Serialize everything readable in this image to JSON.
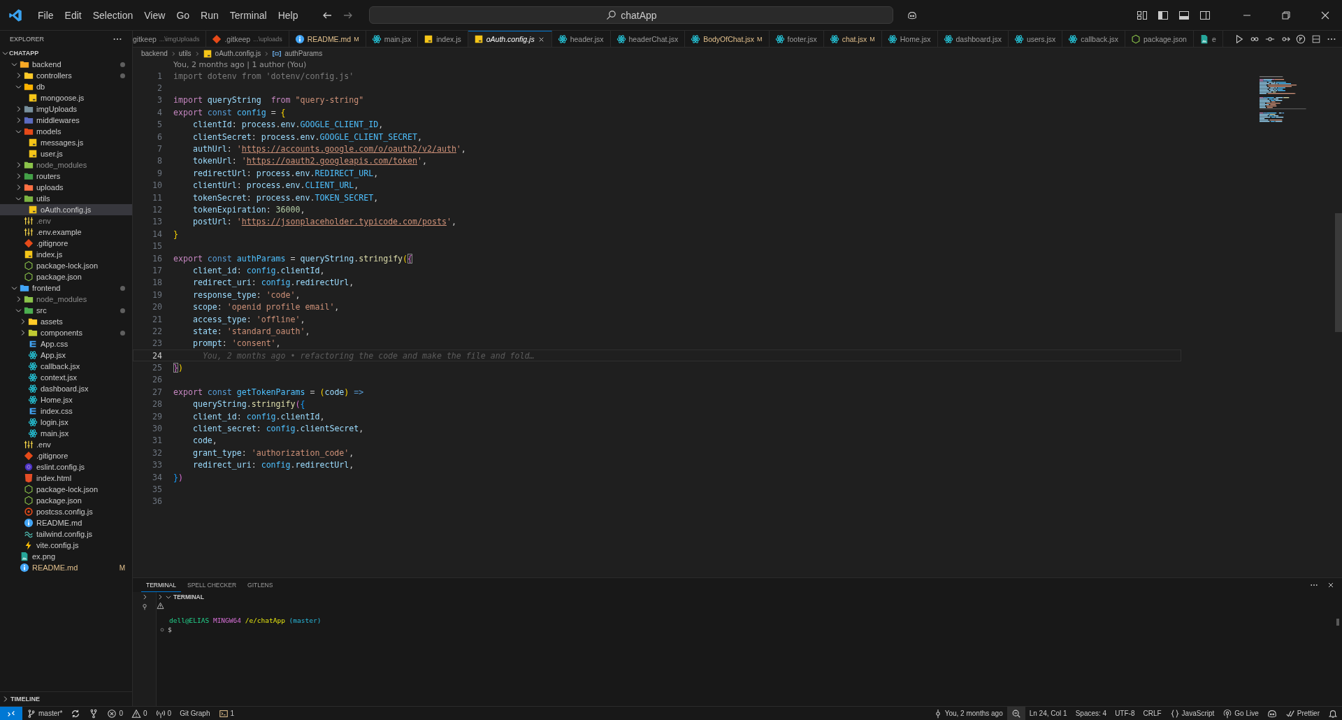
{
  "title_bar": {
    "menus": [
      "File",
      "Edit",
      "Selection",
      "View",
      "Go",
      "Run",
      "Terminal",
      "Help"
    ],
    "search": "chatApp"
  },
  "sidebar": {
    "title": "EXPLORER",
    "root": {
      "label": "CHATAPP",
      "expanded": true
    },
    "tree": [
      {
        "label": "backend",
        "kind": "folder",
        "color": "#f9a825",
        "expanded": true,
        "selected": false,
        "dimmed": false,
        "modified": false,
        "dot": true,
        "children": [
          {
            "label": "controllers",
            "kind": "folder",
            "color": "#ffca28",
            "expanded": false,
            "selected": false,
            "dimmed": false,
            "modified": false,
            "dot": true
          },
          {
            "label": "db",
            "kind": "folder",
            "color": "#ffb300",
            "expanded": true,
            "selected": false,
            "dimmed": false,
            "modified": false,
            "dot": false,
            "children": [
              {
                "label": "mongoose.js",
                "kind": "js",
                "selected": false,
                "dimmed": false,
                "modified": false
              }
            ]
          },
          {
            "label": "imgUploads",
            "kind": "folder",
            "color": "#78909c",
            "expanded": false,
            "selected": false,
            "dimmed": false,
            "modified": false,
            "dot": false
          },
          {
            "label": "middlewares",
            "kind": "folder",
            "color": "#5c6bc0",
            "expanded": false,
            "selected": false,
            "dimmed": false,
            "modified": false,
            "dot": false
          },
          {
            "label": "models",
            "kind": "folder",
            "color": "#e64a19",
            "expanded": true,
            "selected": false,
            "dimmed": false,
            "modified": false,
            "dot": false,
            "children": [
              {
                "label": "messages.js",
                "kind": "js",
                "selected": false,
                "dimmed": false,
                "modified": false
              },
              {
                "label": "user.js",
                "kind": "js",
                "selected": false,
                "dimmed": false,
                "modified": false
              }
            ]
          },
          {
            "label": "node_modules",
            "kind": "folder",
            "color": "#8bc34a",
            "expanded": false,
            "selected": false,
            "dimmed": true,
            "modified": false,
            "dot": false
          },
          {
            "label": "routers",
            "kind": "folder",
            "color": "#43a047",
            "expanded": false,
            "selected": false,
            "dimmed": false,
            "modified": false,
            "dot": false
          },
          {
            "label": "uploads",
            "kind": "folder",
            "color": "#ff7043",
            "expanded": false,
            "selected": false,
            "dimmed": false,
            "modified": false,
            "dot": false
          },
          {
            "label": "utils",
            "kind": "folder",
            "color": "#7cb342",
            "expanded": true,
            "selected": false,
            "dimmed": false,
            "modified": false,
            "dot": false,
            "children": [
              {
                "label": "oAuth.config.js",
                "kind": "js",
                "selected": true,
                "dimmed": false,
                "modified": false
              }
            ]
          },
          {
            "label": ".env",
            "kind": "env",
            "selected": false,
            "dimmed": true,
            "modified": false
          },
          {
            "label": ".env.example",
            "kind": "env",
            "selected": false,
            "dimmed": false,
            "modified": false
          },
          {
            "label": ".gitignore",
            "kind": "git",
            "selected": false,
            "dimmed": false,
            "modified": false
          },
          {
            "label": "index.js",
            "kind": "js",
            "selected": false,
            "dimmed": false,
            "modified": false
          },
          {
            "label": "package-lock.json",
            "kind": "node",
            "selected": false,
            "dimmed": false,
            "modified": false
          },
          {
            "label": "package.json",
            "kind": "node",
            "selected": false,
            "dimmed": false,
            "modified": false
          }
        ]
      },
      {
        "label": "frontend",
        "kind": "folder",
        "color": "#42a5f5",
        "expanded": true,
        "selected": false,
        "dimmed": false,
        "modified": false,
        "dot": true,
        "children": [
          {
            "label": "node_modules",
            "kind": "folder",
            "color": "#8bc34a",
            "expanded": false,
            "selected": false,
            "dimmed": true,
            "modified": false,
            "dot": false
          },
          {
            "label": "src",
            "kind": "folder",
            "color": "#4caf50",
            "expanded": true,
            "selected": false,
            "dimmed": false,
            "modified": false,
            "dot": true,
            "children": [
              {
                "label": "assets",
                "kind": "folder",
                "color": "#ffca28",
                "expanded": false,
                "selected": false,
                "dimmed": false,
                "modified": false,
                "dot": false
              },
              {
                "label": "components",
                "kind": "folder",
                "color": "#c0ca33",
                "expanded": false,
                "selected": false,
                "dimmed": false,
                "modified": false,
                "dot": true
              },
              {
                "label": "App.css",
                "kind": "css",
                "selected": false,
                "dimmed": false,
                "modified": false
              },
              {
                "label": "App.jsx",
                "kind": "react",
                "selected": false,
                "dimmed": false,
                "modified": false
              },
              {
                "label": "callback.jsx",
                "kind": "react",
                "selected": false,
                "dimmed": false,
                "modified": false
              },
              {
                "label": "context.jsx",
                "kind": "react",
                "selected": false,
                "dimmed": false,
                "modified": false
              },
              {
                "label": "dashboard.jsx",
                "kind": "react",
                "selected": false,
                "dimmed": false,
                "modified": false
              },
              {
                "label": "Home.jsx",
                "kind": "react",
                "selected": false,
                "dimmed": false,
                "modified": false
              },
              {
                "label": "index.css",
                "kind": "css",
                "selected": false,
                "dimmed": false,
                "modified": false
              },
              {
                "label": "login.jsx",
                "kind": "react",
                "selected": false,
                "dimmed": false,
                "modified": false
              },
              {
                "label": "main.jsx",
                "kind": "react",
                "selected": false,
                "dimmed": false,
                "modified": false
              }
            ]
          },
          {
            "label": ".env",
            "kind": "env",
            "selected": false,
            "dimmed": false,
            "modified": false
          },
          {
            "label": ".gitignore",
            "kind": "git",
            "selected": false,
            "dimmed": false,
            "modified": false
          },
          {
            "label": "eslint.config.js",
            "kind": "eslint",
            "selected": false,
            "dimmed": false,
            "modified": false
          },
          {
            "label": "index.html",
            "kind": "html",
            "selected": false,
            "dimmed": false,
            "modified": false
          },
          {
            "label": "package-lock.json",
            "kind": "node",
            "selected": false,
            "dimmed": false,
            "modified": false
          },
          {
            "label": "package.json",
            "kind": "node",
            "selected": false,
            "dimmed": false,
            "modified": false
          },
          {
            "label": "postcss.config.js",
            "kind": "postcss",
            "selected": false,
            "dimmed": false,
            "modified": false
          },
          {
            "label": "README.md",
            "kind": "info",
            "selected": false,
            "dimmed": false,
            "modified": false
          },
          {
            "label": "tailwind.config.js",
            "kind": "tailwind",
            "selected": false,
            "dimmed": false,
            "modified": false
          },
          {
            "label": "vite.config.js",
            "kind": "vite",
            "selected": false,
            "dimmed": false,
            "modified": false
          }
        ]
      },
      {
        "label": "ex.png",
        "kind": "image",
        "selected": false,
        "dimmed": false,
        "modified": false
      },
      {
        "label": "README.md",
        "kind": "info",
        "selected": false,
        "dimmed": false,
        "modified": true,
        "badge": "M"
      }
    ],
    "timeline": {
      "label": "TIMELINE",
      "expanded": false
    }
  },
  "tabs": [
    {
      "label": "gitkeep",
      "description": "...\\imgUploads",
      "kind": "plain",
      "selected": false,
      "preview": false,
      "modified": false
    },
    {
      "label": ".gitkeep",
      "description": "...\\uploads",
      "kind": "git",
      "selected": false,
      "preview": false,
      "modified": false
    },
    {
      "label": "README.md",
      "kind": "info",
      "selected": false,
      "preview": false,
      "modified": true,
      "badge": "M"
    },
    {
      "label": "main.jsx",
      "kind": "react",
      "selected": false,
      "preview": false,
      "modified": false
    },
    {
      "label": "index.js",
      "kind": "js",
      "selected": false,
      "preview": false,
      "modified": false
    },
    {
      "label": "oAuth.config.js",
      "kind": "js",
      "selected": true,
      "preview": true,
      "modified": false
    },
    {
      "label": "header.jsx",
      "kind": "react",
      "selected": false,
      "preview": false,
      "modified": false
    },
    {
      "label": "headerChat.jsx",
      "kind": "react",
      "selected": false,
      "preview": false,
      "modified": false
    },
    {
      "label": "BodyOfChat.jsx",
      "kind": "react",
      "selected": false,
      "preview": false,
      "modified": true,
      "badge": "M"
    },
    {
      "label": "footer.jsx",
      "kind": "react",
      "selected": false,
      "preview": false,
      "modified": false
    },
    {
      "label": "chat.jsx",
      "kind": "react",
      "selected": false,
      "preview": false,
      "modified": true,
      "badge": "M"
    },
    {
      "label": "Home.jsx",
      "kind": "react",
      "selected": false,
      "preview": false,
      "modified": false
    },
    {
      "label": "dashboard.jsx",
      "kind": "react",
      "selected": false,
      "preview": false,
      "modified": false
    },
    {
      "label": "users.jsx",
      "kind": "react",
      "selected": false,
      "preview": false,
      "modified": false
    },
    {
      "label": "callback.jsx",
      "kind": "react",
      "selected": false,
      "preview": false,
      "modified": false
    },
    {
      "label": "package.json",
      "kind": "node",
      "selected": false,
      "preview": false,
      "modified": false
    },
    {
      "label": "e",
      "kind": "image",
      "selected": false,
      "preview": false,
      "modified": false
    }
  ],
  "breadcrumb": [
    {
      "label": "backend",
      "kind": "plain"
    },
    {
      "label": "utils",
      "kind": "plain"
    },
    {
      "label": "oAuth.config.js",
      "kind": "js"
    },
    {
      "label": "authParams",
      "kind": "symbol"
    }
  ],
  "editor": {
    "codelens": "You, 2 months ago | 1 author (You)",
    "lines": [
      {
        "number": "1",
        "current": false,
        "tokens": [
          {
            "text": "import dotenv from 'dotenv/config.js'",
            "kind": "faded"
          }
        ]
      },
      {
        "number": "2",
        "current": false
      },
      {
        "number": "3",
        "current": false,
        "tokens": [
          {
            "text": "import",
            "kind": "kw"
          },
          {
            "text": " queryString  ",
            "kind": "var"
          },
          {
            "text": "from",
            "kind": "kw"
          },
          {
            "text": " \"query-string\"",
            "kind": "str"
          }
        ]
      },
      {
        "number": "4",
        "current": false,
        "tokens": [
          {
            "text": "export",
            "kind": "kw"
          },
          {
            "text": " const",
            "kind": "st"
          },
          {
            "text": " config",
            "kind": "cst"
          },
          {
            "text": " = ",
            "kind": "p"
          },
          {
            "text": "{",
            "kind": "b1"
          }
        ]
      },
      {
        "number": "5",
        "current": false,
        "tokens": [
          {
            "text": "    clientId",
            "kind": "var"
          },
          {
            "text": ": ",
            "kind": "p"
          },
          {
            "text": "process",
            "kind": "var"
          },
          {
            "text": ".",
            "kind": "p"
          },
          {
            "text": "env",
            "kind": "var"
          },
          {
            "text": ".",
            "kind": "p"
          },
          {
            "text": "GOOGLE_CLIENT_ID",
            "kind": "cst"
          },
          {
            "text": ",",
            "kind": "p"
          }
        ]
      },
      {
        "number": "6",
        "current": false,
        "tokens": [
          {
            "text": "    clientSecret",
            "kind": "var"
          },
          {
            "text": ": ",
            "kind": "p"
          },
          {
            "text": "process",
            "kind": "var"
          },
          {
            "text": ".",
            "kind": "p"
          },
          {
            "text": "env",
            "kind": "var"
          },
          {
            "text": ".",
            "kind": "p"
          },
          {
            "text": "GOOGLE_CLIENT_SECRET",
            "kind": "cst"
          },
          {
            "text": ",",
            "kind": "p"
          }
        ]
      },
      {
        "number": "7",
        "current": false,
        "tokens": [
          {
            "text": "    authUrl",
            "kind": "var"
          },
          {
            "text": ": ",
            "kind": "p"
          },
          {
            "text": "'",
            "kind": "str"
          },
          {
            "text": "https://accounts.google.com/o/oauth2/v2/auth",
            "kind": "link"
          },
          {
            "text": "'",
            "kind": "str"
          },
          {
            "text": ",",
            "kind": "p"
          }
        ]
      },
      {
        "number": "8",
        "current": false,
        "tokens": [
          {
            "text": "    tokenUrl",
            "kind": "var"
          },
          {
            "text": ": ",
            "kind": "p"
          },
          {
            "text": "'",
            "kind": "str"
          },
          {
            "text": "https://oauth2.googleapis.com/token",
            "kind": "link"
          },
          {
            "text": "'",
            "kind": "str"
          },
          {
            "text": ",",
            "kind": "p"
          }
        ]
      },
      {
        "number": "9",
        "current": false,
        "tokens": [
          {
            "text": "    redirectUrl",
            "kind": "var"
          },
          {
            "text": ": ",
            "kind": "p"
          },
          {
            "text": "process",
            "kind": "var"
          },
          {
            "text": ".",
            "kind": "p"
          },
          {
            "text": "env",
            "kind": "var"
          },
          {
            "text": ".",
            "kind": "p"
          },
          {
            "text": "REDIRECT_URL",
            "kind": "cst"
          },
          {
            "text": ",",
            "kind": "p"
          }
        ]
      },
      {
        "number": "10",
        "current": false,
        "tokens": [
          {
            "text": "    clientUrl",
            "kind": "var"
          },
          {
            "text": ": ",
            "kind": "p"
          },
          {
            "text": "process",
            "kind": "var"
          },
          {
            "text": ".",
            "kind": "p"
          },
          {
            "text": "env",
            "kind": "var"
          },
          {
            "text": ".",
            "kind": "p"
          },
          {
            "text": "CLIENT_URL",
            "kind": "cst"
          },
          {
            "text": ",",
            "kind": "p"
          }
        ]
      },
      {
        "number": "11",
        "current": false,
        "tokens": [
          {
            "text": "    tokenSecret",
            "kind": "var"
          },
          {
            "text": ": ",
            "kind": "p"
          },
          {
            "text": "process",
            "kind": "var"
          },
          {
            "text": ".",
            "kind": "p"
          },
          {
            "text": "env",
            "kind": "var"
          },
          {
            "text": ".",
            "kind": "p"
          },
          {
            "text": "TOKEN_SECRET",
            "kind": "cst"
          },
          {
            "text": ",",
            "kind": "p"
          }
        ]
      },
      {
        "number": "12",
        "current": false,
        "tokens": [
          {
            "text": "    tokenExpiration",
            "kind": "var"
          },
          {
            "text": ": ",
            "kind": "p"
          },
          {
            "text": "36000",
            "kind": "num"
          },
          {
            "text": ",",
            "kind": "p"
          }
        ]
      },
      {
        "number": "13",
        "current": false,
        "tokens": [
          {
            "text": "    postUrl",
            "kind": "var"
          },
          {
            "text": ": ",
            "kind": "p"
          },
          {
            "text": "'",
            "kind": "str"
          },
          {
            "text": "https://jsonplaceholder.typicode.com/posts",
            "kind": "link"
          },
          {
            "text": "'",
            "kind": "str"
          },
          {
            "text": ",",
            "kind": "p"
          }
        ]
      },
      {
        "number": "14",
        "current": false,
        "tokens": [
          {
            "text": "}",
            "kind": "b1"
          }
        ]
      },
      {
        "number": "15",
        "current": false
      },
      {
        "number": "16",
        "current": false,
        "tokens": [
          {
            "text": "export",
            "kind": "kw"
          },
          {
            "text": " const",
            "kind": "st"
          },
          {
            "text": " authParams",
            "kind": "cst"
          },
          {
            "text": " = ",
            "kind": "p"
          },
          {
            "text": "queryString",
            "kind": "var"
          },
          {
            "text": ".",
            "kind": "p"
          },
          {
            "text": "stringify",
            "kind": "fn"
          },
          {
            "text": "(",
            "kind": "b1"
          },
          {
            "text": "{",
            "kind": "b2m"
          }
        ]
      },
      {
        "number": "17",
        "current": false,
        "tokens": [
          {
            "text": "    client_id",
            "kind": "var"
          },
          {
            "text": ": ",
            "kind": "p"
          },
          {
            "text": "config",
            "kind": "cst"
          },
          {
            "text": ".",
            "kind": "p"
          },
          {
            "text": "clientId",
            "kind": "var"
          },
          {
            "text": ",",
            "kind": "p"
          }
        ]
      },
      {
        "number": "18",
        "current": false,
        "tokens": [
          {
            "text": "    redirect_uri",
            "kind": "var"
          },
          {
            "text": ": ",
            "kind": "p"
          },
          {
            "text": "config",
            "kind": "cst"
          },
          {
            "text": ".",
            "kind": "p"
          },
          {
            "text": "redirectUrl",
            "kind": "var"
          },
          {
            "text": ",",
            "kind": "p"
          }
        ]
      },
      {
        "number": "19",
        "current": false,
        "tokens": [
          {
            "text": "    response_type",
            "kind": "var"
          },
          {
            "text": ": ",
            "kind": "p"
          },
          {
            "text": "'code'",
            "kind": "str"
          },
          {
            "text": ",",
            "kind": "p"
          }
        ]
      },
      {
        "number": "20",
        "current": false,
        "tokens": [
          {
            "text": "    scope",
            "kind": "var"
          },
          {
            "text": ": ",
            "kind": "p"
          },
          {
            "text": "'openid profile email'",
            "kind": "str"
          },
          {
            "text": ",",
            "kind": "p"
          }
        ]
      },
      {
        "number": "21",
        "current": false,
        "tokens": [
          {
            "text": "    access_type",
            "kind": "var"
          },
          {
            "text": ": ",
            "kind": "p"
          },
          {
            "text": "'offline'",
            "kind": "str"
          },
          {
            "text": ",",
            "kind": "p"
          }
        ]
      },
      {
        "number": "22",
        "current": false,
        "tokens": [
          {
            "text": "    state",
            "kind": "var"
          },
          {
            "text": ": ",
            "kind": "p"
          },
          {
            "text": "'standard_oauth'",
            "kind": "str"
          },
          {
            "text": ",",
            "kind": "p"
          }
        ]
      },
      {
        "number": "23",
        "current": false,
        "tokens": [
          {
            "text": "    prompt",
            "kind": "var"
          },
          {
            "text": ": ",
            "kind": "p"
          },
          {
            "text": "'consent'",
            "kind": "str"
          },
          {
            "text": ",",
            "kind": "p"
          }
        ]
      },
      {
        "number": "24",
        "current": true,
        "tokens": [
          {
            "text": "      You, 2 months ago • refactoring the code and make the file and fold…",
            "kind": "ghost"
          }
        ]
      },
      {
        "number": "25",
        "current": false,
        "tokens": [
          {
            "text": "}",
            "kind": "b2m"
          },
          {
            "text": ")",
            "kind": "b1"
          }
        ]
      },
      {
        "number": "26",
        "current": false
      },
      {
        "number": "27",
        "current": false,
        "tokens": [
          {
            "text": "export",
            "kind": "kw"
          },
          {
            "text": " const",
            "kind": "st"
          },
          {
            "text": " getTokenParams",
            "kind": "cst"
          },
          {
            "text": " = ",
            "kind": "p"
          },
          {
            "text": "(",
            "kind": "b1"
          },
          {
            "text": "code",
            "kind": "var"
          },
          {
            "text": ")",
            "kind": "b1"
          },
          {
            "text": " =>",
            "kind": "st"
          }
        ]
      },
      {
        "number": "28",
        "current": false,
        "tokens": [
          {
            "text": "    queryString",
            "kind": "var"
          },
          {
            "text": ".",
            "kind": "p"
          },
          {
            "text": "stringify",
            "kind": "fn"
          },
          {
            "text": "(",
            "kind": "b2"
          },
          {
            "text": "{",
            "kind": "b3"
          }
        ]
      },
      {
        "number": "29",
        "current": false,
        "tokens": [
          {
            "text": "    client_id",
            "kind": "var"
          },
          {
            "text": ": ",
            "kind": "p"
          },
          {
            "text": "config",
            "kind": "cst"
          },
          {
            "text": ".",
            "kind": "p"
          },
          {
            "text": "clientId",
            "kind": "var"
          },
          {
            "text": ",",
            "kind": "p"
          }
        ]
      },
      {
        "number": "30",
        "current": false,
        "tokens": [
          {
            "text": "    client_secret",
            "kind": "var"
          },
          {
            "text": ": ",
            "kind": "p"
          },
          {
            "text": "config",
            "kind": "cst"
          },
          {
            "text": ".",
            "kind": "p"
          },
          {
            "text": "clientSecret",
            "kind": "var"
          },
          {
            "text": ",",
            "kind": "p"
          }
        ]
      },
      {
        "number": "31",
        "current": false,
        "tokens": [
          {
            "text": "    code",
            "kind": "var"
          },
          {
            "text": ",",
            "kind": "p"
          }
        ]
      },
      {
        "number": "32",
        "current": false,
        "tokens": [
          {
            "text": "    grant_type",
            "kind": "var"
          },
          {
            "text": ": ",
            "kind": "p"
          },
          {
            "text": "'authorization_code'",
            "kind": "str"
          },
          {
            "text": ",",
            "kind": "p"
          }
        ]
      },
      {
        "number": "33",
        "current": false,
        "tokens": [
          {
            "text": "    redirect_uri",
            "kind": "var"
          },
          {
            "text": ": ",
            "kind": "p"
          },
          {
            "text": "config",
            "kind": "cst"
          },
          {
            "text": ".",
            "kind": "p"
          },
          {
            "text": "redirectUrl",
            "kind": "var"
          },
          {
            "text": ",",
            "kind": "p"
          }
        ]
      },
      {
        "number": "34",
        "current": false,
        "tokens": [
          {
            "text": "}",
            "kind": "b3"
          },
          {
            "text": ")",
            "kind": "b2"
          }
        ]
      },
      {
        "number": "35",
        "current": false
      },
      {
        "number": "36",
        "current": false
      }
    ]
  },
  "panel": {
    "tabs": [
      {
        "label": "TERMINAL",
        "selected": true
      },
      {
        "label": "SPELL CHECKER",
        "selected": false
      },
      {
        "label": "GITLENS",
        "selected": false
      }
    ],
    "section": "TERMINAL",
    "terminal": [
      {
        "kind": "output",
        "parts": [
          {
            "text": "dell@ELIAS",
            "kind": "user"
          },
          {
            "text": " MINGW64",
            "kind": "system"
          },
          {
            "text": " /e/chatApp",
            "kind": "path"
          },
          {
            "text": " (master)",
            "kind": "branch"
          }
        ]
      },
      {
        "kind": "prompt",
        "parts": [
          {
            "text": "$",
            "kind": "plain"
          }
        ]
      }
    ]
  },
  "status_bar": {
    "left": [
      {
        "kind": "remote"
      },
      {
        "kind": "branch",
        "text": "master*"
      },
      {
        "kind": "sync"
      },
      {
        "kind": "fork"
      },
      {
        "kind": "error",
        "text": "0"
      },
      {
        "kind": "warning",
        "text": "0"
      },
      {
        "kind": "ports",
        "text": "0"
      },
      {
        "kind": "plain",
        "text": "Git Graph"
      },
      {
        "kind": "terminal",
        "text": "1"
      }
    ],
    "right": [
      {
        "kind": "commit",
        "text": "You, 2 months ago"
      },
      {
        "kind": "zoom"
      },
      {
        "kind": "plain",
        "text": "Ln 24, Col 1"
      },
      {
        "kind": "plain",
        "text": "Spaces: 4"
      },
      {
        "kind": "plain",
        "text": "UTF-8"
      },
      {
        "kind": "plain",
        "text": "CRLF"
      },
      {
        "kind": "braces",
        "text": "JavaScript"
      },
      {
        "kind": "broadcast",
        "text": "Go Live"
      },
      {
        "kind": "copilot"
      },
      {
        "kind": "check",
        "text": "Prettier"
      },
      {
        "kind": "bell"
      }
    ]
  }
}
